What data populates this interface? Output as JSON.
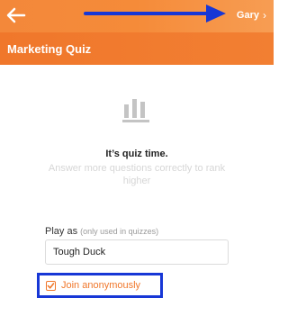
{
  "header": {
    "user_name": "Gary",
    "user_chevron": "›",
    "back_icon": "arrow-left-icon"
  },
  "title_bar": {
    "title": "Marketing Quiz"
  },
  "hero": {
    "icon": "bar-chart-icon",
    "headline": "It’s quiz time.",
    "subtext": "Answer more questions correctly to rank higher"
  },
  "form": {
    "play_as_label": "Play as",
    "play_as_hint": "(only used in quizzes)",
    "name_value": "Tough Duck",
    "anonymous_label": "Join anonymously",
    "anonymous_checked": true
  },
  "colors": {
    "accent": "#f0772b",
    "annotation": "#1737d6",
    "muted_text": "#d6d6d6"
  }
}
